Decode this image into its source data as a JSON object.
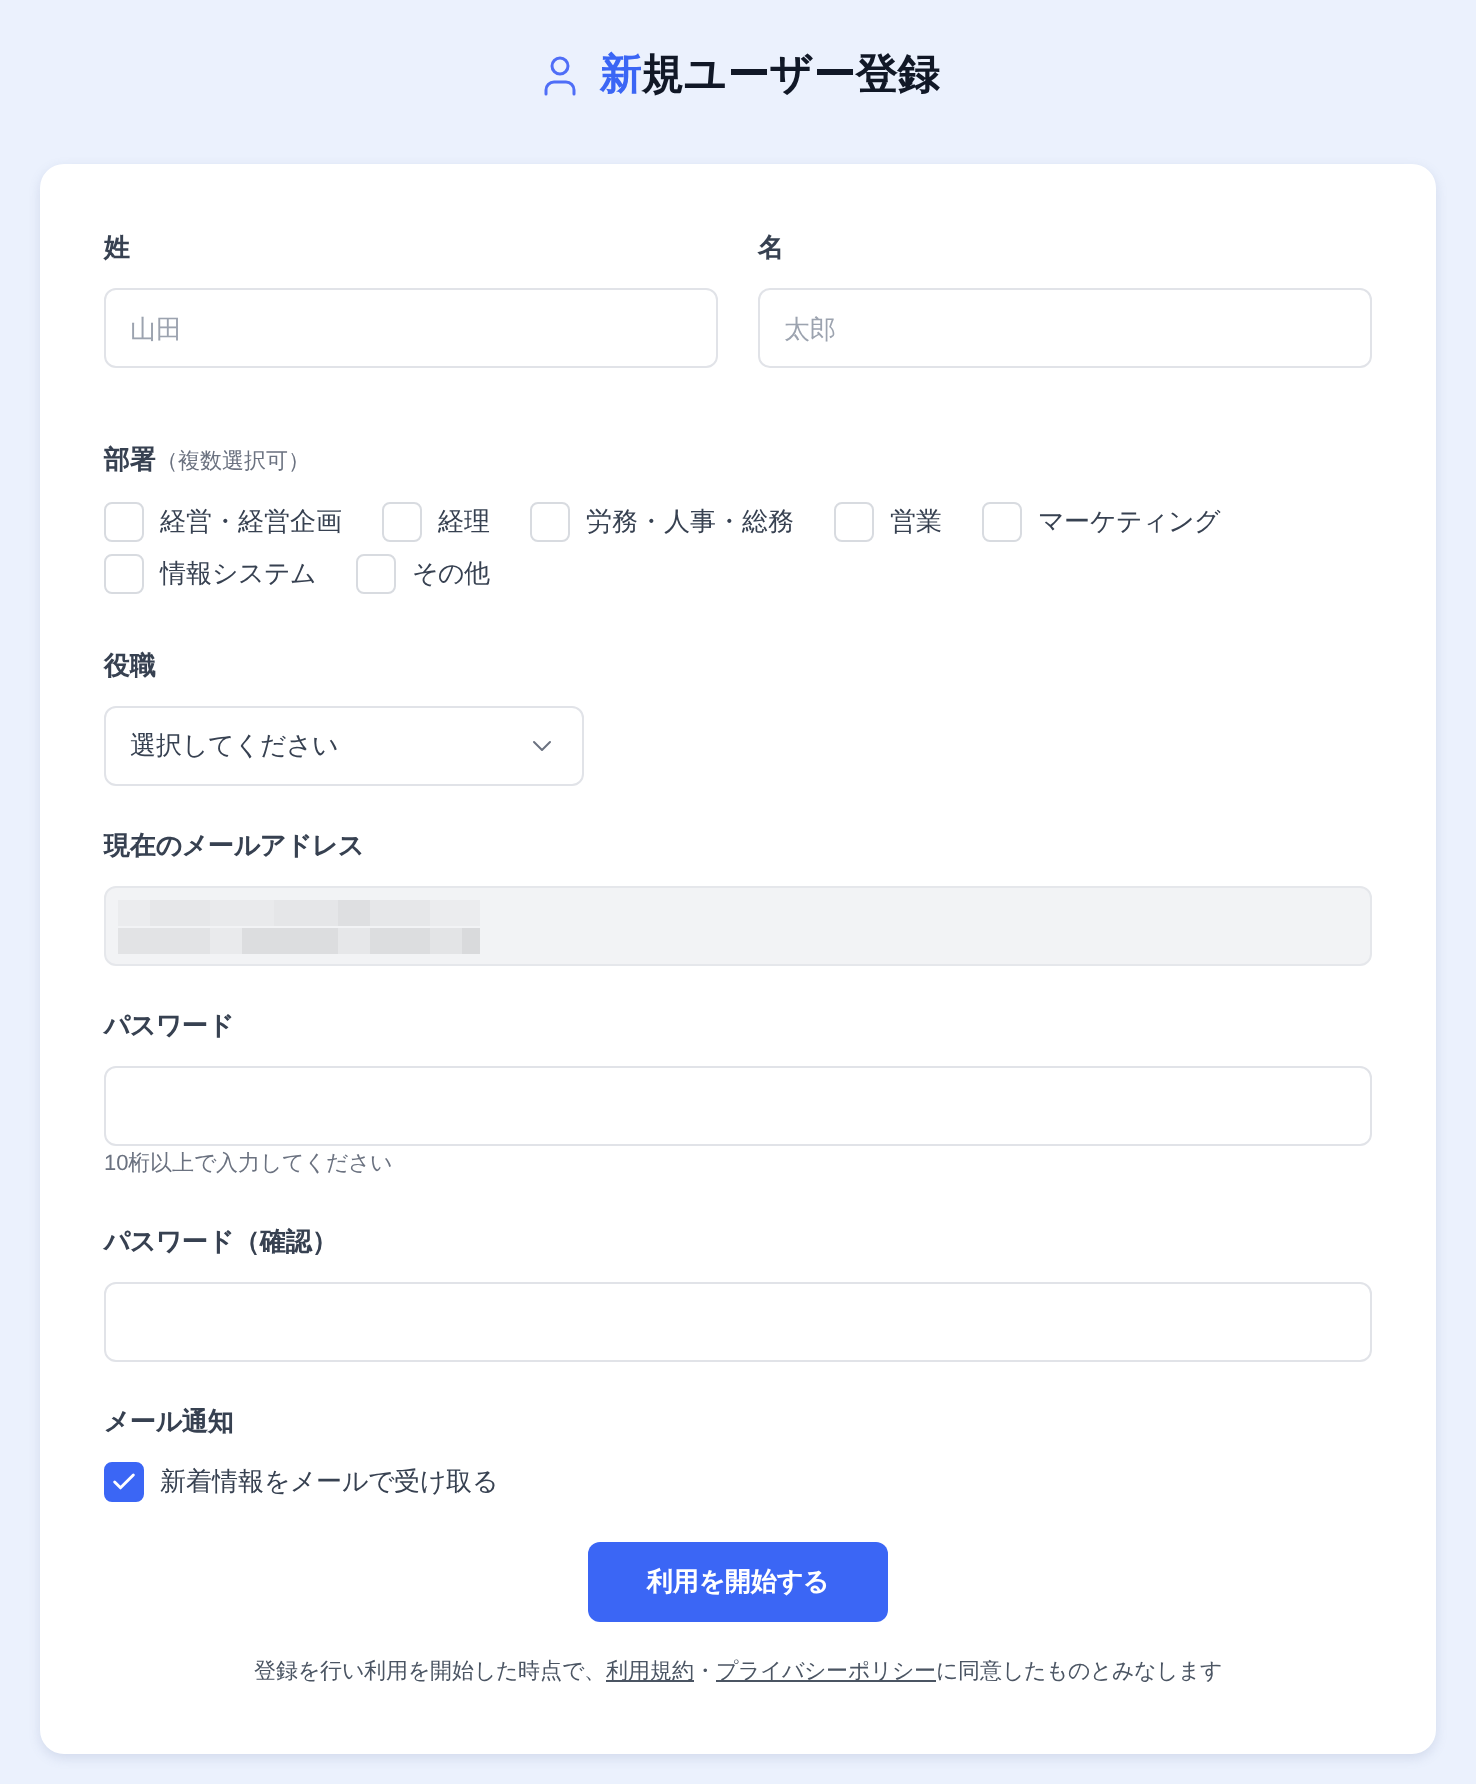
{
  "title": {
    "highlight": "新",
    "text": "規ユーザー登録"
  },
  "name_fields": [
    {
      "label": "姓",
      "placeholder": "山田"
    },
    {
      "label": "名",
      "placeholder": "太郎"
    }
  ],
  "department": {
    "label": "部署",
    "note": "（複数選択可）",
    "options": [
      {
        "label": "経営・経営企画",
        "checked": false
      },
      {
        "label": "経理",
        "checked": false
      },
      {
        "label": "労務・人事・総務",
        "checked": false
      },
      {
        "label": "営業",
        "checked": false
      },
      {
        "label": "マーケティング",
        "checked": false
      },
      {
        "label": "情報システム",
        "checked": false
      },
      {
        "label": "その他",
        "checked": false
      }
    ]
  },
  "role": {
    "label": "役職",
    "value": "選択してください"
  },
  "email": {
    "label": "現在のメールアドレス",
    "disabled": true
  },
  "password": {
    "label": "パスワード",
    "hint": "10桁以上で入力してください"
  },
  "password_confirm": {
    "label": "パスワード（確認）"
  },
  "notification": {
    "label": "メール通知",
    "option": {
      "label": "新着情報をメールで受け取る",
      "checked": true
    }
  },
  "submit_button": "利用を開始する",
  "consent": [
    {
      "kind": "text",
      "text": "登録を行い利用を開始した時点で、"
    },
    {
      "kind": "link",
      "text": "利用規約"
    },
    {
      "kind": "text",
      "text": "・"
    },
    {
      "kind": "link",
      "text": "プライバシーポリシー"
    },
    {
      "kind": "text",
      "text": "に同意したものとみなします"
    }
  ]
}
